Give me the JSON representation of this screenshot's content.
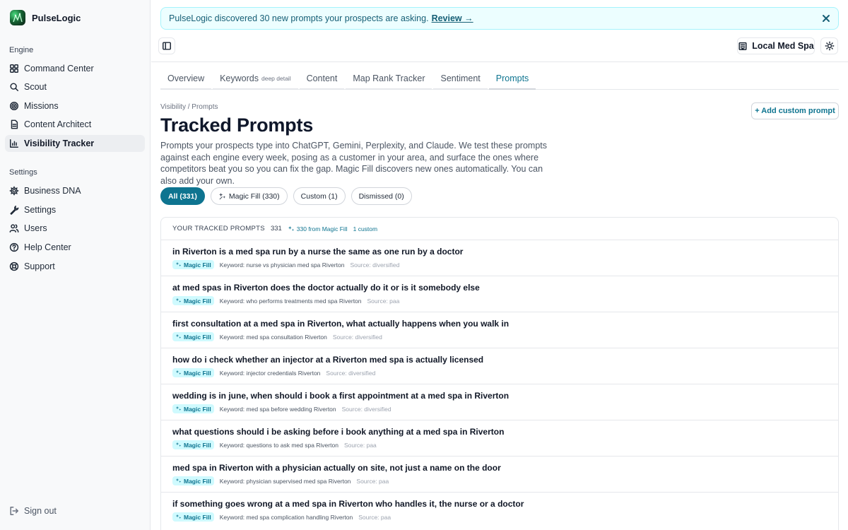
{
  "brand": {
    "name": "PulseLogic"
  },
  "sidebar": {
    "engine_label": "Engine",
    "engine_items": [
      {
        "label": "Command Center",
        "icon": "grid-icon"
      },
      {
        "label": "Scout",
        "icon": "search-icon"
      },
      {
        "label": "Missions",
        "icon": "target-icon"
      },
      {
        "label": "Content Architect",
        "icon": "document-icon"
      },
      {
        "label": "Visibility Tracker",
        "icon": "bar-chart-icon",
        "active": true
      }
    ],
    "settings_label": "Settings",
    "settings_items": [
      {
        "label": "Business DNA",
        "icon": "gear-icon"
      },
      {
        "label": "Settings",
        "icon": "wrench-icon"
      },
      {
        "label": "Users",
        "icon": "users-icon"
      },
      {
        "label": "Help Center",
        "icon": "help-circle-icon"
      },
      {
        "label": "Support",
        "icon": "lifebuoy-icon"
      }
    ],
    "signout_label": "Sign out"
  },
  "banner": {
    "message": "PulseLogic discovered 30 new prompts your prospects are asking.",
    "link": "Review →"
  },
  "header": {
    "location": "Local Med Spa"
  },
  "tabs": [
    {
      "label": "Overview",
      "sub": ""
    },
    {
      "label": "Keywords",
      "sub": "deep detail"
    },
    {
      "label": "Content",
      "sub": ""
    },
    {
      "label": "Map Rank Tracker",
      "sub": ""
    },
    {
      "label": "Sentiment",
      "sub": ""
    },
    {
      "label": "Prompts",
      "sub": "",
      "active": true
    }
  ],
  "page": {
    "breadcrumb": "Visibility / Prompts",
    "title": "Tracked Prompts",
    "add_button": "+ Add custom prompt",
    "description": "Prompts your prospects type into ChatGPT, Gemini, Perplexity, and Claude. We test these prompts against each engine every week, posing as a customer in your area, and surface the ones where competitors beat you so you can fix the gap. Magic Fill discovers new ones automatically. You can also add your own."
  },
  "filters": [
    {
      "label": "All (331)",
      "active": true
    },
    {
      "label": "Magic Fill (330)",
      "icon": true
    },
    {
      "label": "Custom (1)"
    },
    {
      "label": "Dismissed (0)"
    }
  ],
  "panel": {
    "title": "YOUR TRACKED PROMPTS",
    "count": "331",
    "magic_fill": "330 from Magic Fill",
    "custom": "1 custom",
    "badge_label": "Magic Fill",
    "rows": [
      {
        "text": "in Riverton is a med spa run by a nurse the same as one run by a doctor",
        "keyword": "Keyword: nurse vs physician med spa Riverton",
        "source": "Source: diversified"
      },
      {
        "text": "at med spas in Riverton does the doctor actually do it or is it somebody else",
        "keyword": "Keyword: who performs treatments med spa Riverton",
        "source": "Source: paa"
      },
      {
        "text": "first consultation at a med spa in Riverton, what actually happens when you walk in",
        "keyword": "Keyword: med spa consultation Riverton",
        "source": "Source: diversified"
      },
      {
        "text": "how do i check whether an injector at a Riverton med spa is actually licensed",
        "keyword": "Keyword: injector credentials Riverton",
        "source": "Source: diversified"
      },
      {
        "text": "wedding is in june, when should i book a first appointment at a med spa in Riverton",
        "keyword": "Keyword: med spa before wedding Riverton",
        "source": "Source: diversified"
      },
      {
        "text": "what questions should i be asking before i book anything at a med spa in Riverton",
        "keyword": "Keyword: questions to ask med spa Riverton",
        "source": "Source: paa"
      },
      {
        "text": "med spa in Riverton with a physician actually on site, not just a name on the door",
        "keyword": "Keyword: physician supervised med spa Riverton",
        "source": "Source: paa"
      },
      {
        "text": "if something goes wrong at a med spa in Riverton who handles it, the nurse or a doctor",
        "keyword": "Keyword: med spa complication handling Riverton",
        "source": "Source: paa"
      }
    ]
  },
  "colors": {
    "accent": "#0e7490",
    "banner_bg": "#ecfeff",
    "badge_bg": "#cffafe"
  }
}
